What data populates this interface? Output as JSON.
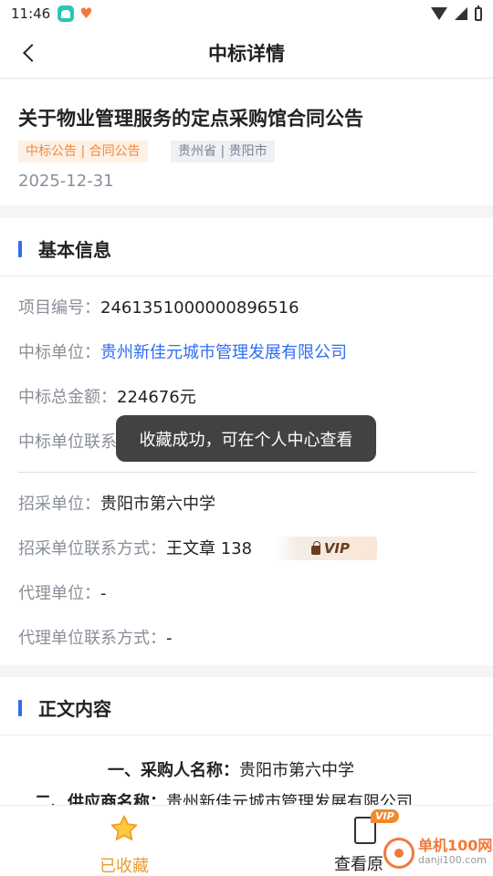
{
  "status_bar": {
    "time": "11:46"
  },
  "header": {
    "title": "中标详情"
  },
  "notice": {
    "title": "关于物业管理服务的定点采购馆合同公告",
    "tag_type": "中标公告 | 合同公告",
    "tag_region": "贵州省 | 贵阳市",
    "date": "2025-12-31"
  },
  "basic_info": {
    "section_title": "基本信息",
    "project_no_label": "项目编号：",
    "project_no": "2461351000000896516",
    "winner_label": "中标单位：",
    "winner": "贵州新佳元城市管理发展有限公司",
    "total_label": "中标总金额：",
    "total": "224676元",
    "winner_contact_label": "中标单位联系",
    "buyer_label": "招采单位：",
    "buyer": "贵阳市第六中学",
    "buyer_contact_label": "招采单位联系方式：",
    "buyer_contact": "王文章 138",
    "vip_text": "VIP",
    "agent_label": "代理单位：",
    "agent": "-",
    "agent_contact_label": "代理单位联系方式：",
    "agent_contact": "-"
  },
  "toast": "收藏成功，可在个人中心查看",
  "content": {
    "section_title": "正文内容",
    "line1_label": "一、采购人名称：",
    "line1_value": "贵阳市第六中学",
    "line2_label": "二、供应商名称：",
    "line2_value": "贵州新佳元城市管理发展有限公司"
  },
  "bottom_bar": {
    "favorited_label": "已收藏",
    "view_original_label": "查看原",
    "vip_badge": "VIP"
  },
  "watermark": {
    "name": "单机100网",
    "url": "danji100.com"
  },
  "colors": {
    "accent_blue": "#2f6df0",
    "accent_orange": "#ef8a3a"
  }
}
